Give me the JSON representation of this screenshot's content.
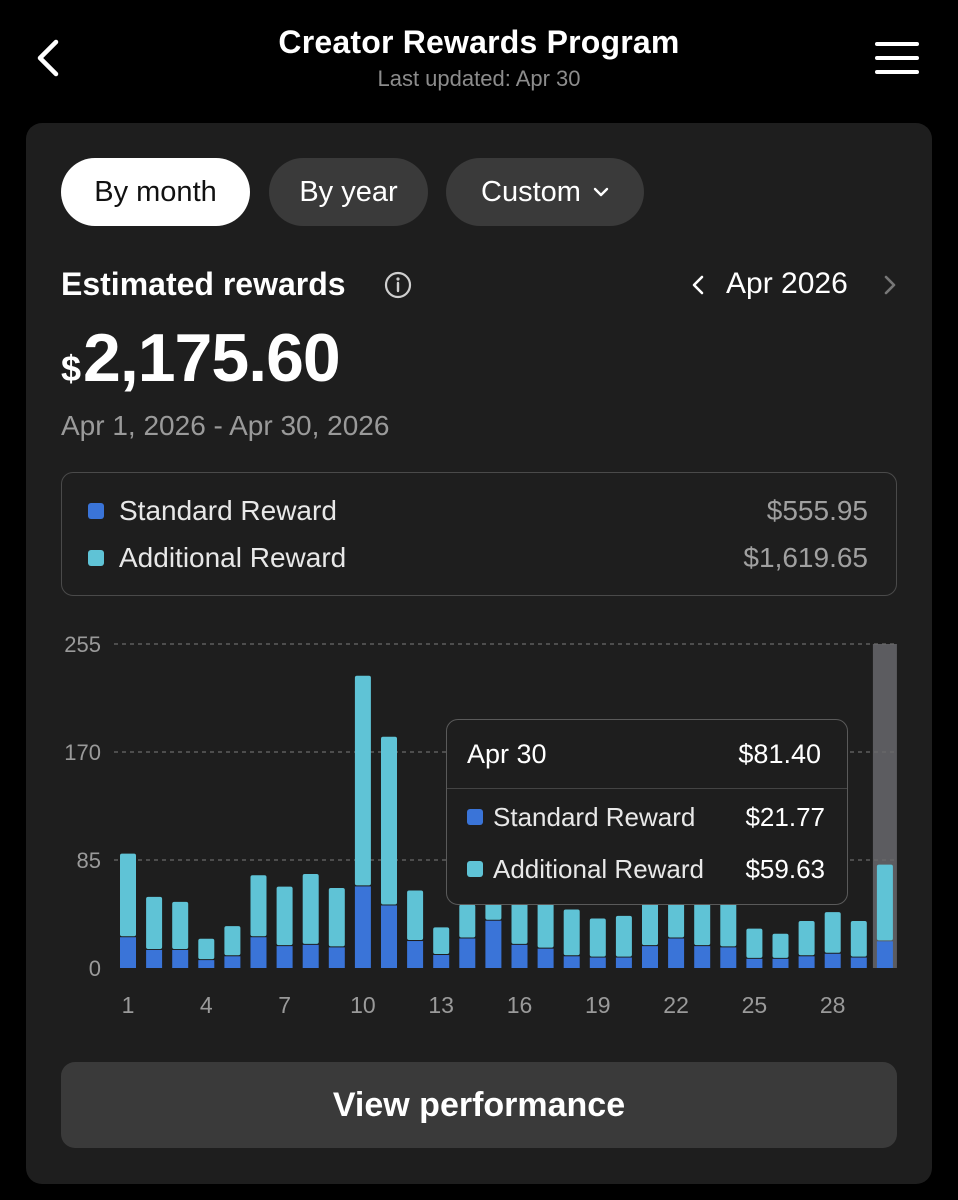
{
  "header": {
    "title": "Creator Rewards Program",
    "subtitle": "Last updated: Apr 30"
  },
  "filters": {
    "by_month": "By month",
    "by_year": "By year",
    "custom": "Custom",
    "selected": "By month"
  },
  "rewards": {
    "label": "Estimated rewards",
    "period": "Apr 2026",
    "currency": "$",
    "amount": "2,175.60",
    "date_range": "Apr 1, 2026 - Apr 30, 2026"
  },
  "legend": [
    {
      "name": "Standard Reward",
      "amount": "$555.95",
      "color": "#3a74d8"
    },
    {
      "name": "Additional Reward",
      "amount": "$1,619.65",
      "color": "#5fc3d6"
    }
  ],
  "tooltip": {
    "date": "Apr 30",
    "total": "$81.40",
    "rows": [
      {
        "name": "Standard Reward",
        "amount": "$21.77"
      },
      {
        "name": "Additional Reward",
        "amount": "$59.63"
      }
    ]
  },
  "chart_data": {
    "type": "bar",
    "stacked": true,
    "categories": [
      1,
      2,
      3,
      4,
      5,
      6,
      7,
      8,
      9,
      10,
      11,
      12,
      13,
      14,
      15,
      16,
      17,
      18,
      19,
      20,
      21,
      22,
      23,
      24,
      25,
      26,
      27,
      28,
      29,
      30
    ],
    "x_tick_labels": [
      "1",
      "4",
      "7",
      "10",
      "13",
      "16",
      "19",
      "22",
      "25",
      "28"
    ],
    "y_ticks": [
      0,
      85,
      170,
      255
    ],
    "ylim": [
      0,
      255
    ],
    "grid": true,
    "highlighted_category": 30,
    "series": [
      {
        "name": "Standard Reward",
        "color": "#3a74d8",
        "values": [
          25,
          15,
          15,
          7,
          10,
          25,
          18,
          19,
          17,
          65,
          50,
          22,
          11,
          24,
          38,
          19,
          16,
          10,
          9,
          9,
          18,
          24,
          18,
          17,
          8,
          8,
          10,
          12,
          9,
          21.77
        ]
      },
      {
        "name": "Additional Reward",
        "color": "#5fc3d6",
        "values": [
          65,
          41,
          37,
          16,
          23,
          48,
          46,
          55,
          46,
          165,
          132,
          39,
          21,
          26,
          17,
          43,
          47,
          36,
          30,
          32,
          43,
          37,
          44,
          40,
          23,
          19,
          27,
          32,
          28,
          59.63
        ]
      }
    ]
  },
  "actions": {
    "view_performance": "View performance"
  }
}
